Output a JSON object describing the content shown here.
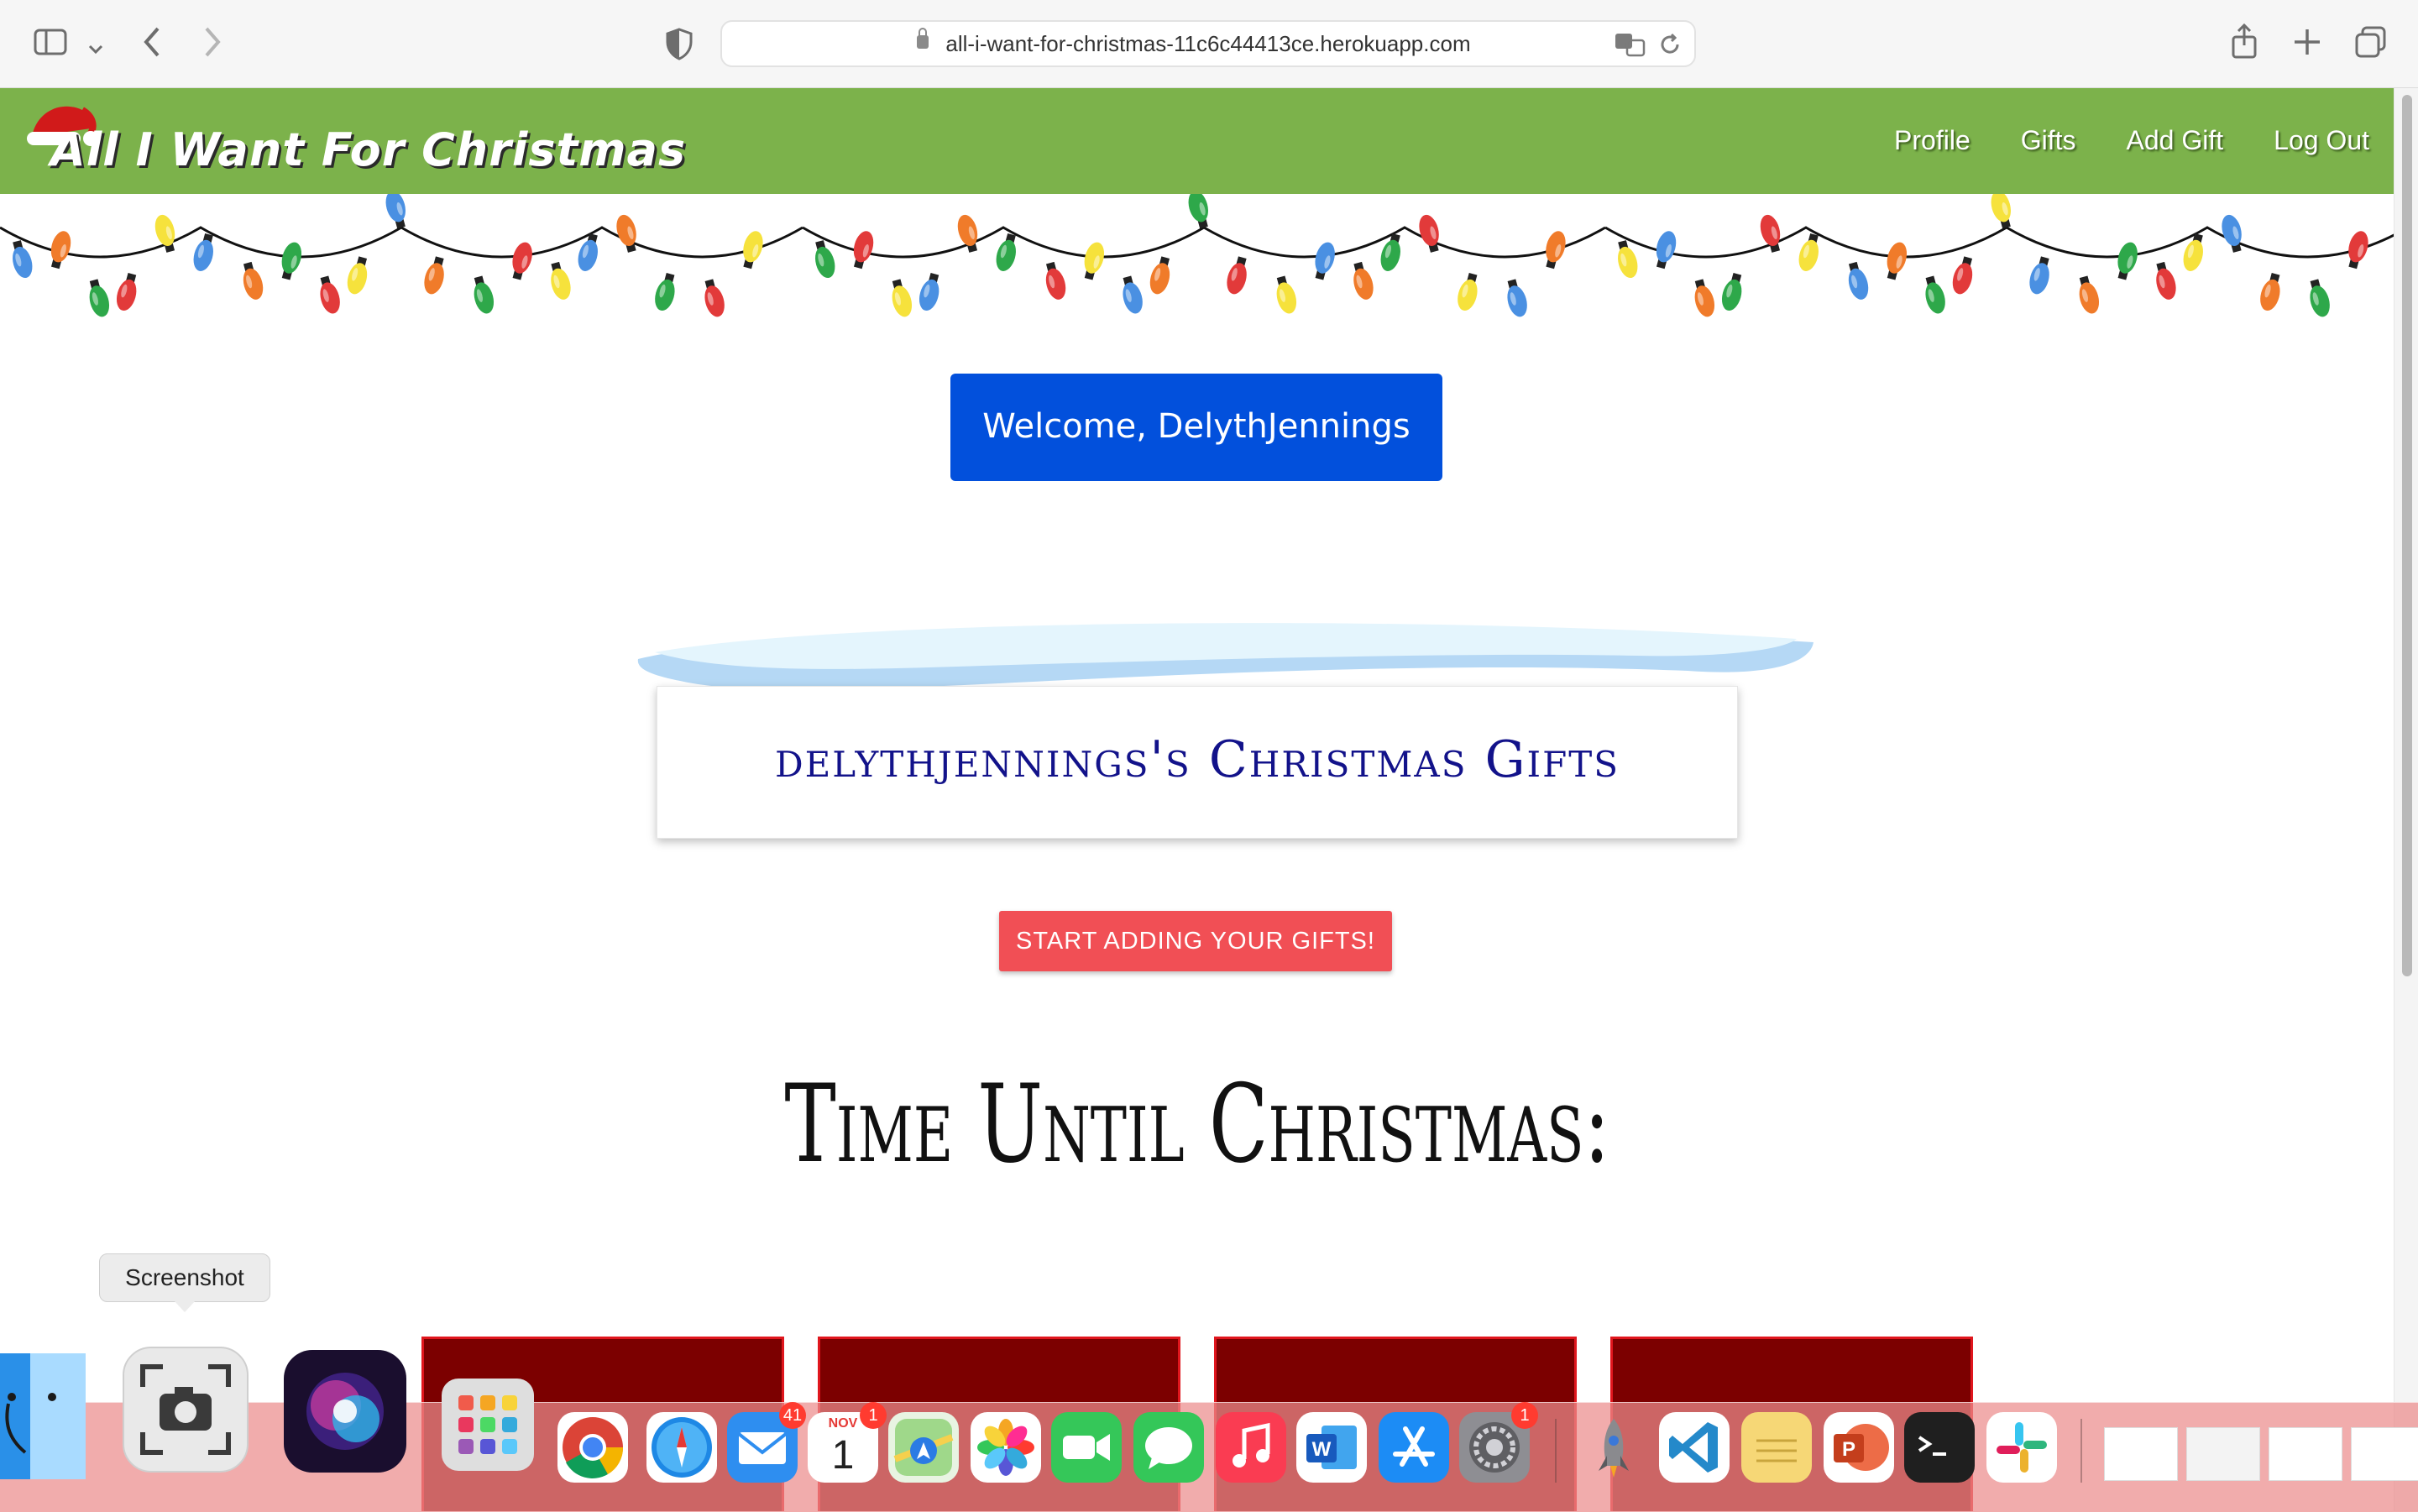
{
  "browser": {
    "url": "all-i-want-for-christmas-11c6c44413ce.herokuapp.com"
  },
  "navbar": {
    "brand": "All I Want For Christmas",
    "links": [
      "Profile",
      "Gifts",
      "Add Gift",
      "Log Out"
    ],
    "color": "#7cb24b"
  },
  "main": {
    "welcome": "Welcome, DelythJennings",
    "gifts_title": "delythjennings's Christmas Gifts",
    "start_button": "START ADDING YOUR GIFTS!",
    "countdown_title": "Time Until Christmas:"
  },
  "dock": {
    "tooltip": "Screenshot",
    "mail_badge": "41",
    "calendar_badge": "1",
    "calendar_month": "NOV",
    "calendar_day": "1",
    "settings_badge": "1"
  }
}
